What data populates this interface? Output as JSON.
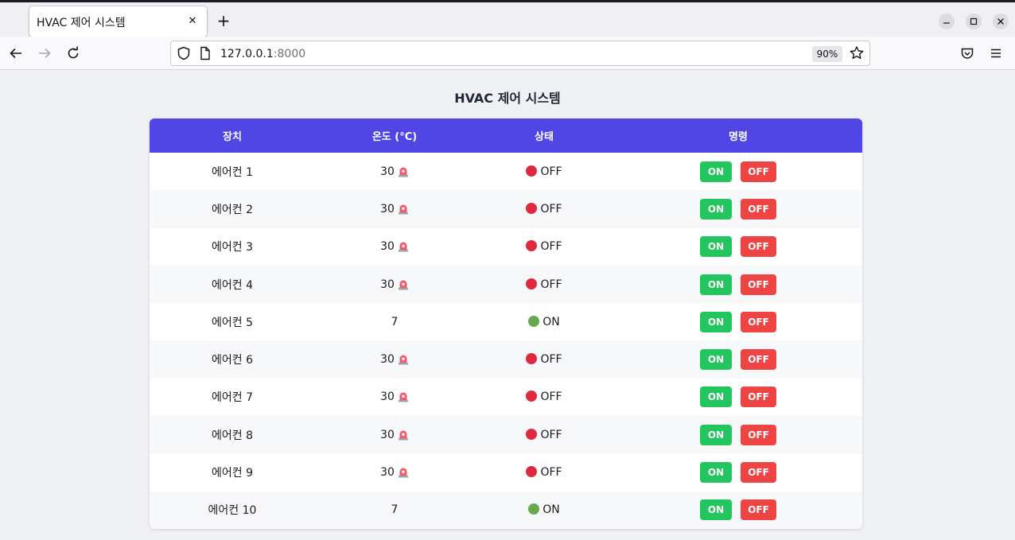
{
  "browser": {
    "tab_title": "HVAC 제어 시스템",
    "url_host": "127.0.0.1",
    "url_port": ":8000",
    "zoom": "90%"
  },
  "page": {
    "title": "HVAC 제어 시스템"
  },
  "table": {
    "headers": [
      "장치",
      "온도 (°C)",
      "상태",
      "명령"
    ],
    "on_label": "ON",
    "off_label": "OFF",
    "rows": [
      {
        "device": "에어컨 1",
        "temp": "30",
        "alarm": true,
        "status": "OFF"
      },
      {
        "device": "에어컨 2",
        "temp": "30",
        "alarm": true,
        "status": "OFF"
      },
      {
        "device": "에어컨 3",
        "temp": "30",
        "alarm": true,
        "status": "OFF"
      },
      {
        "device": "에어컨 4",
        "temp": "30",
        "alarm": true,
        "status": "OFF"
      },
      {
        "device": "에어컨 5",
        "temp": "7",
        "alarm": false,
        "status": "ON"
      },
      {
        "device": "에어컨 6",
        "temp": "30",
        "alarm": true,
        "status": "OFF"
      },
      {
        "device": "에어컨 7",
        "temp": "30",
        "alarm": true,
        "status": "OFF"
      },
      {
        "device": "에어컨 8",
        "temp": "30",
        "alarm": true,
        "status": "OFF"
      },
      {
        "device": "에어컨 9",
        "temp": "30",
        "alarm": true,
        "status": "OFF"
      },
      {
        "device": "에어컨 10",
        "temp": "7",
        "alarm": false,
        "status": "ON"
      }
    ]
  },
  "colors": {
    "header_bg": "#4f46e5",
    "on_button": "#22c55e",
    "off_button": "#ef4444",
    "status_off_dot": "#e0283e",
    "status_on_dot": "#6aa84f"
  }
}
